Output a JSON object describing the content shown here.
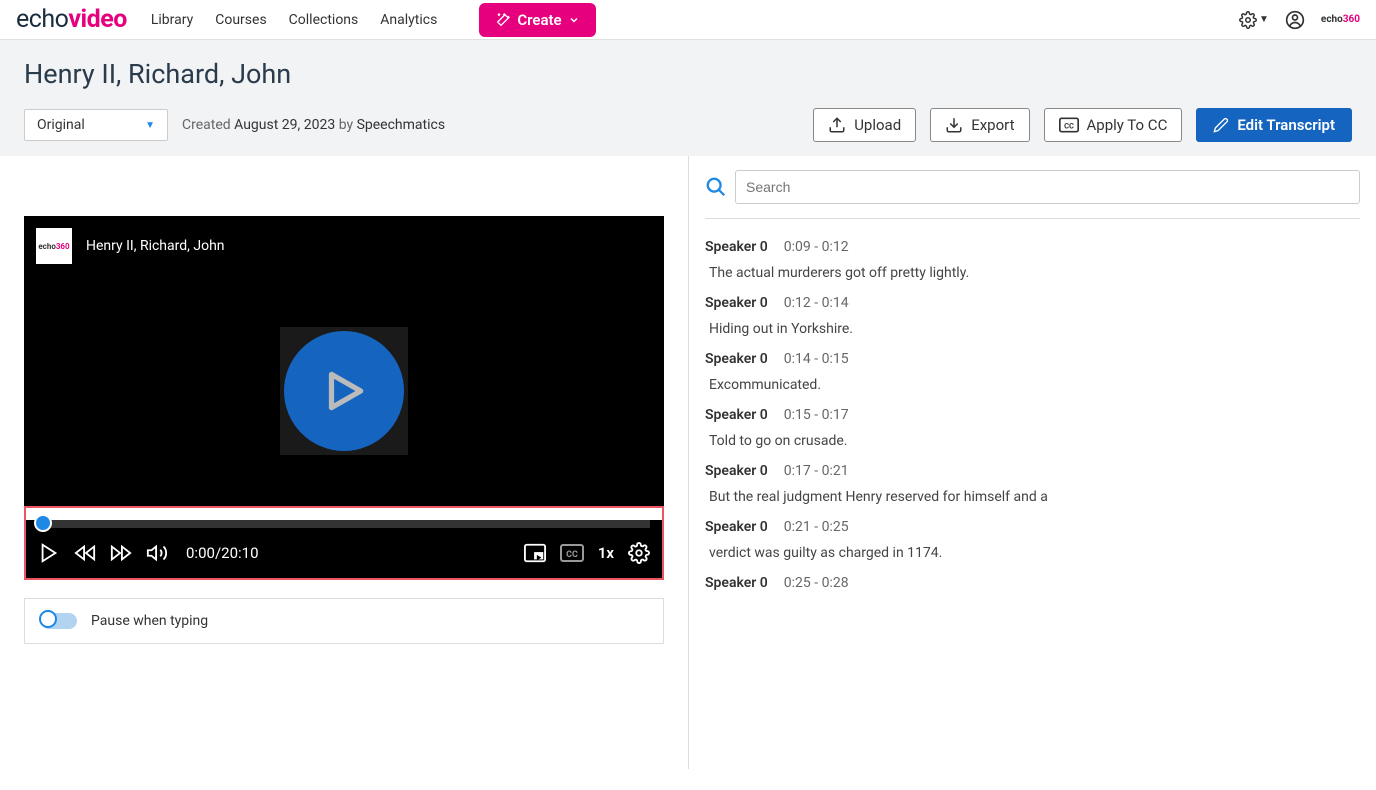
{
  "nav": {
    "links": [
      "Library",
      "Courses",
      "Collections",
      "Analytics"
    ],
    "create": "Create"
  },
  "header": {
    "title": "Henry II, Richard, John",
    "dropdown": "Original",
    "created_prefix": "Created ",
    "created_date": "August 29, 2023",
    "created_by": " by ",
    "created_author": "Speechmatics",
    "upload": "Upload",
    "export": "Export",
    "apply_cc": "Apply To CC",
    "edit_transcript": "Edit Transcript"
  },
  "video": {
    "title": "Henry II, Richard, John",
    "time_current": "0:00",
    "time_total": "20:10",
    "speed": "1x"
  },
  "pause_typing_label": "Pause when typing",
  "search_placeholder": "Search",
  "transcript": [
    {
      "speaker": "Speaker 0",
      "time": "0:09 - 0:12",
      "text": "The actual murderers got off pretty lightly."
    },
    {
      "speaker": "Speaker 0",
      "time": "0:12 - 0:14",
      "text": "Hiding out in Yorkshire."
    },
    {
      "speaker": "Speaker 0",
      "time": "0:14 - 0:15",
      "text": "Excommunicated."
    },
    {
      "speaker": "Speaker 0",
      "time": "0:15 - 0:17",
      "text": "Told to go on crusade."
    },
    {
      "speaker": "Speaker 0",
      "time": "0:17 - 0:21",
      "text": "But the real judgment Henry reserved for himself and a"
    },
    {
      "speaker": "Speaker 0",
      "time": "0:21 - 0:25",
      "text": "verdict was guilty as charged in 1174."
    },
    {
      "speaker": "Speaker 0",
      "time": "0:25 - 0:28",
      "text": ""
    }
  ]
}
